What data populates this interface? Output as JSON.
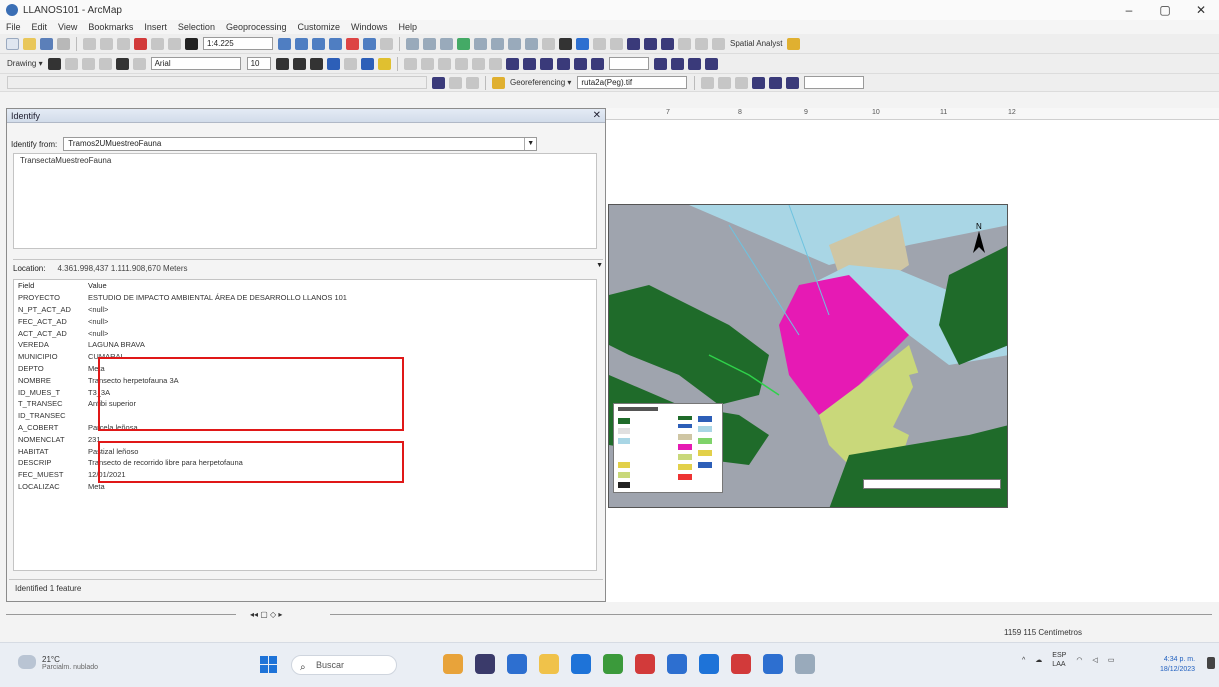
{
  "window": {
    "title": "LLANOS101 - ArcMap",
    "controls": [
      "–",
      "▢",
      "✕"
    ]
  },
  "menu": [
    "File",
    "Edit",
    "View",
    "Bookmarks",
    "Insert",
    "Selection",
    "Geoprocessing",
    "Customize",
    "Windows",
    "Help"
  ],
  "toolbar1": {
    "scale": "1:4.225",
    "spatial_label": "Spatial Analyst"
  },
  "toolbar2": {
    "drawing_label": "Drawing ▾",
    "font_select": "Arial",
    "size_select": "10"
  },
  "toolbar3": {
    "georef_label": "Georeferencing ▾",
    "layer_select": "ruta2a(Peg).tif"
  },
  "identify": {
    "title": "Identify",
    "identify_from_label": "Identify from:",
    "layer_value": "Tramos2UMuestreoFauna",
    "tree_node": "TransectaMuestreoFauna",
    "location_label": "Location:",
    "location_value": "4.361.998,437  1.111.908,670 Meters",
    "columns": {
      "field": "Field",
      "value": "Value"
    },
    "rows": [
      {
        "field": "PROYECTO",
        "value": "ESTUDIO DE IMPACTO AMBIENTAL ÁREA DE DESARROLLO LLANOS 101"
      },
      {
        "field": "N_PT_ACT_AD",
        "value": "<null>"
      },
      {
        "field": "FEC_ACT_AD",
        "value": "<null>"
      },
      {
        "field": "ACT_ACT_AD",
        "value": "<null>"
      },
      {
        "field": "VEREDA",
        "value": "LAGUNA BRAVA"
      },
      {
        "field": "MUNICIPIO",
        "value": "CUMARAL"
      },
      {
        "field": "DEPTO",
        "value": "Meta"
      },
      {
        "field": "NOMBRE",
        "value": "Transecto herpetofauna 3A"
      },
      {
        "field": "ID_MUES_T",
        "value": "T3_3A"
      },
      {
        "field": "T_TRANSEC",
        "value": "Anfibi superior"
      },
      {
        "field": "ID_TRANSEC",
        "value": ""
      },
      {
        "field": "A_COBERT",
        "value": "Parcela leñosa"
      },
      {
        "field": "NOMENCLAT",
        "value": "231"
      },
      {
        "field": "HABITAT",
        "value": "Pastizal leñoso"
      },
      {
        "field": "DESCRIP",
        "value": "Transecto de recorrido libre para herpetofauna"
      },
      {
        "field": "FEC_MUEST",
        "value": "12/01/2021"
      },
      {
        "field": "LOCALIZAC",
        "value": "Meta"
      }
    ],
    "status": "Identified 1 feature"
  },
  "layout": {
    "ruler_ticks": [
      "7",
      "8",
      "9",
      "10",
      "11",
      "12"
    ],
    "north_label": "N",
    "legend_title": "Convenciones"
  },
  "bottom": {
    "page_controls": "◂◂ ▢ ◇ ▸",
    "coords": "1159  115  Centímetros"
  },
  "taskbar": {
    "weather_temp": "21°C",
    "weather_desc": "Parcialm. nublado",
    "search_placeholder": "Buscar",
    "tray_lang_1": "ESP",
    "tray_lang_2": "LAA",
    "time": "4:34 p. m.",
    "date": "18/12/2023"
  },
  "colors": {
    "red_highlight": "#e01818",
    "map_gray": "#9fa4ae",
    "map_green": "#1f6b2a",
    "map_magenta": "#e61ab4",
    "map_lightblue": "#a9d6e5",
    "map_yellowgreen": "#c9d87a",
    "map_tan": "#cfc6a4"
  }
}
